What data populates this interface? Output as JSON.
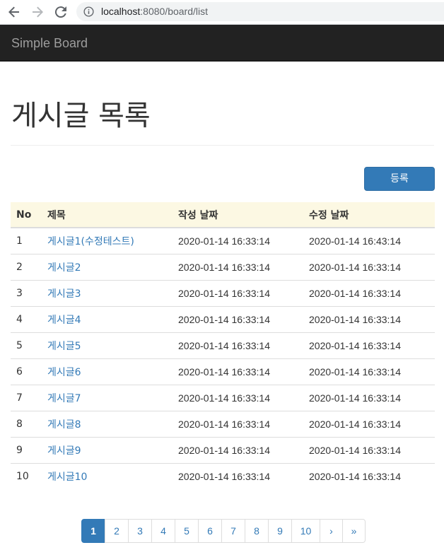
{
  "browser": {
    "url_host": "localhost",
    "url_rest": ":8080/board/list"
  },
  "navbar": {
    "brand": "Simple Board"
  },
  "page": {
    "title": "게시글 목록",
    "register_button": "등록"
  },
  "table": {
    "headers": [
      "No",
      "제목",
      "작성 날짜",
      "수정 날짜"
    ],
    "rows": [
      {
        "no": "1",
        "title": "게시글1(수정테스트)",
        "created": "2020-01-14 16:33:14",
        "modified": "2020-01-14 16:43:14"
      },
      {
        "no": "2",
        "title": "게시글2",
        "created": "2020-01-14 16:33:14",
        "modified": "2020-01-14 16:33:14"
      },
      {
        "no": "3",
        "title": "게시글3",
        "created": "2020-01-14 16:33:14",
        "modified": "2020-01-14 16:33:14"
      },
      {
        "no": "4",
        "title": "게시글4",
        "created": "2020-01-14 16:33:14",
        "modified": "2020-01-14 16:33:14"
      },
      {
        "no": "5",
        "title": "게시글5",
        "created": "2020-01-14 16:33:14",
        "modified": "2020-01-14 16:33:14"
      },
      {
        "no": "6",
        "title": "게시글6",
        "created": "2020-01-14 16:33:14",
        "modified": "2020-01-14 16:33:14"
      },
      {
        "no": "7",
        "title": "게시글7",
        "created": "2020-01-14 16:33:14",
        "modified": "2020-01-14 16:33:14"
      },
      {
        "no": "8",
        "title": "게시글8",
        "created": "2020-01-14 16:33:14",
        "modified": "2020-01-14 16:33:14"
      },
      {
        "no": "9",
        "title": "게시글9",
        "created": "2020-01-14 16:33:14",
        "modified": "2020-01-14 16:33:14"
      },
      {
        "no": "10",
        "title": "게시글10",
        "created": "2020-01-14 16:33:14",
        "modified": "2020-01-14 16:33:14"
      }
    ]
  },
  "pagination": {
    "pages": [
      "1",
      "2",
      "3",
      "4",
      "5",
      "6",
      "7",
      "8",
      "9",
      "10"
    ],
    "active_page": "1",
    "next_label": "›",
    "last_label": "»"
  },
  "colors": {
    "navbar_bg": "#222222",
    "accent": "#337ab7",
    "table_header_bg": "#fcf8e3"
  }
}
